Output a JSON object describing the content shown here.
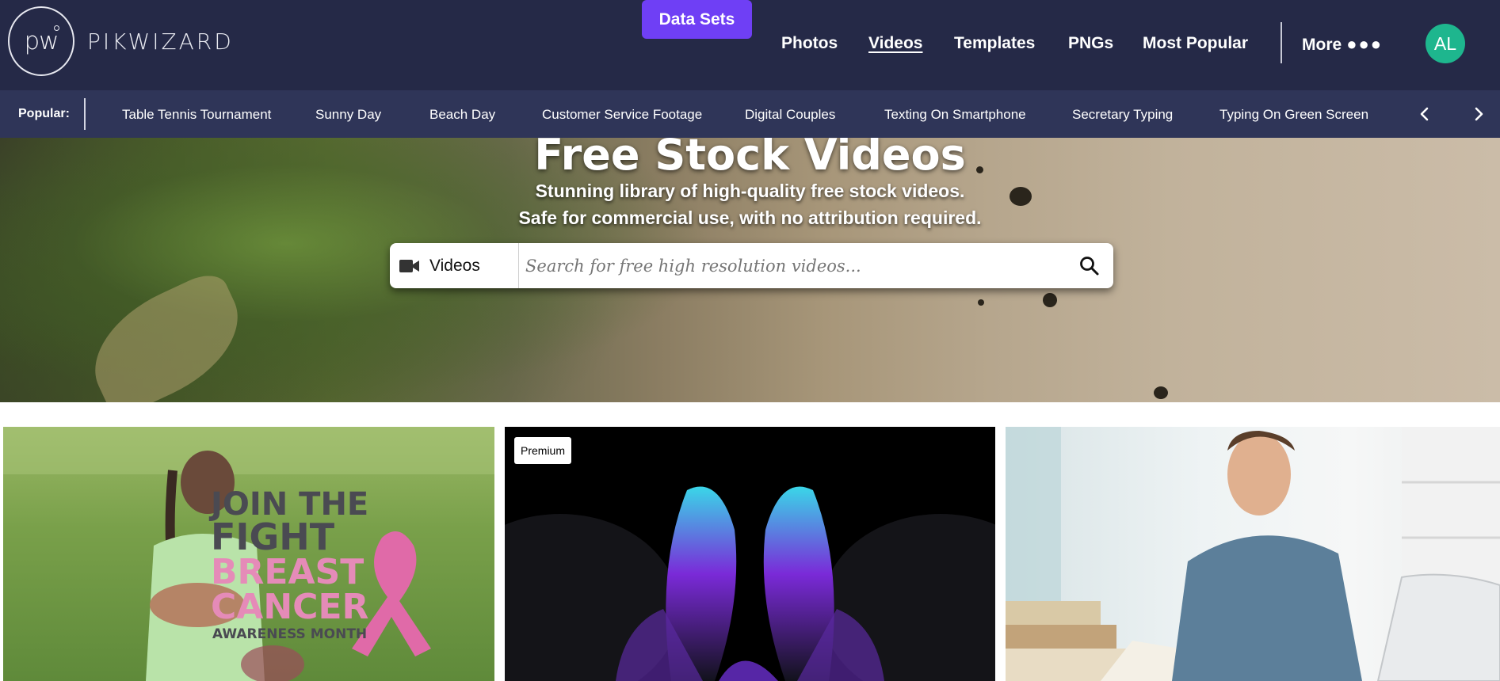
{
  "brand": {
    "logo_mark": "pw",
    "name": "PIKWIZARD"
  },
  "nav": {
    "primary": "Data Sets",
    "links": [
      "Photos",
      "Videos",
      "Templates",
      "PNGs",
      "Most Popular"
    ],
    "active": "Videos",
    "more": "More",
    "more_icon": "ellipsis-icon",
    "avatar_initials": "AL",
    "avatar_color": "#1eb68e",
    "accent": "#6f3ff5"
  },
  "popular": {
    "label": "Popular:",
    "items": [
      "Table Tennis Tournament",
      "Sunny Day",
      "Beach Day",
      "Customer Service Footage",
      "Digital Couples",
      "Texting On Smartphone",
      "Secretary Typing",
      "Typing On Green Screen"
    ]
  },
  "hero": {
    "title": "Free Stock Videos",
    "subtitle_line1": "Stunning library of high-quality free stock videos.",
    "subtitle_line2": "Safe for commercial use, with no attribution required."
  },
  "search": {
    "type_label": "Videos",
    "type_icon": "video-camera-icon",
    "placeholder": "Search for free high resolution videos...",
    "value": ""
  },
  "results": [
    {
      "id": "card1",
      "overlay_lines": [
        "JOIN THE",
        "FIGHT",
        "BREAST",
        "CANCER",
        "AWARENESS MONTH"
      ]
    },
    {
      "id": "card2",
      "badge": "Premium"
    },
    {
      "id": "card3"
    }
  ]
}
